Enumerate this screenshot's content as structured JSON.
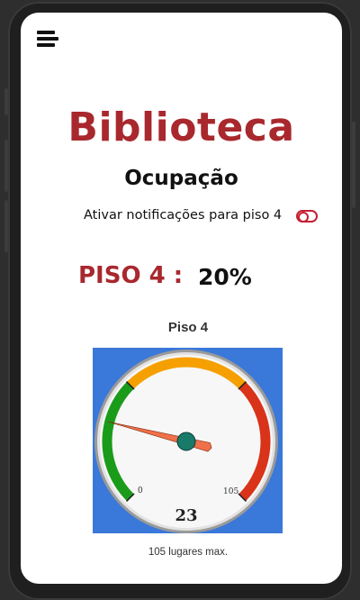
{
  "app": {
    "title": "Biblioteca",
    "subtitle": "Ocupação"
  },
  "menu": {
    "icon": "hamburger-menu-icon"
  },
  "notifications": {
    "label": "Ativar notificações para piso 4",
    "enabled": false,
    "toggle_color": "#c52033"
  },
  "floor": {
    "label": "PISO 4 :",
    "occupancy_percent": "20%"
  },
  "gauge": {
    "title": "Piso 4",
    "min_label": "0",
    "max_label": "105",
    "value": 23,
    "value_label": "23",
    "min": 0,
    "max": 105,
    "bands": [
      {
        "from": 0,
        "to": 35,
        "color": "#1a9c1a"
      },
      {
        "from": 35,
        "to": 70,
        "color": "#f5a000"
      },
      {
        "from": 70,
        "to": 105,
        "color": "#d9331a"
      }
    ],
    "background_color": "#3a78d9",
    "needle_color": "#f0704a",
    "hub_color": "#1a7a6a"
  },
  "capacity_note": "105 lugares max.",
  "colors": {
    "title": "#a8282e",
    "floor_label": "#a8282e"
  }
}
